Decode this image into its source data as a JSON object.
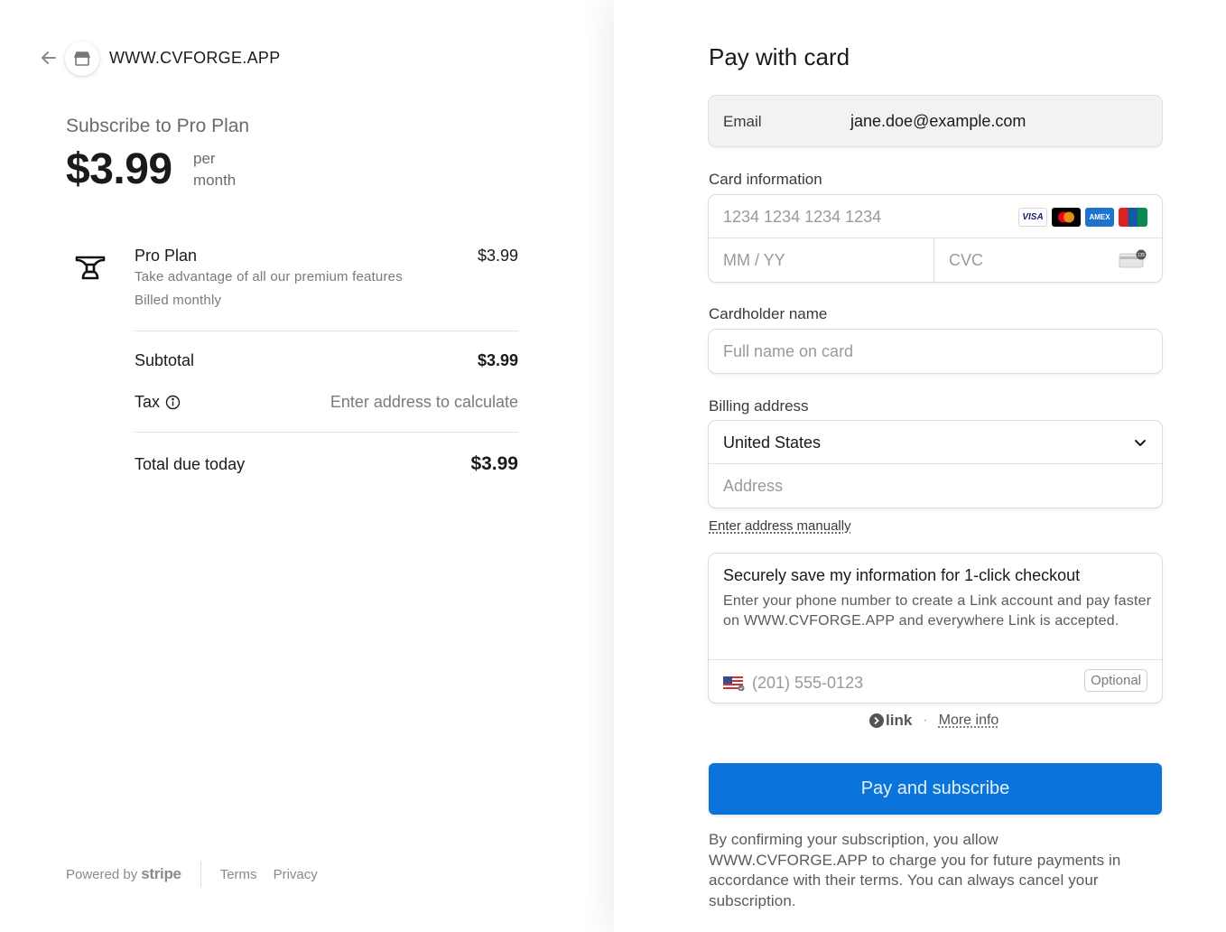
{
  "merchant": {
    "name": "WWW.CVFORGE.APP"
  },
  "summary": {
    "title": "Subscribe to Pro Plan",
    "price": "$3.99",
    "per_line1": "per",
    "per_line2": "month"
  },
  "line_item": {
    "name": "Pro Plan",
    "description": "Take advantage of all our premium features",
    "billing": "Billed monthly",
    "price": "$3.99"
  },
  "totals": {
    "subtotal_label": "Subtotal",
    "subtotal_value": "$3.99",
    "tax_label": "Tax",
    "tax_value": "Enter address to calculate",
    "total_label": "Total due today",
    "total_value": "$3.99"
  },
  "footer": {
    "powered_by": "Powered by",
    "brand": "stripe",
    "terms": "Terms",
    "privacy": "Privacy"
  },
  "payment": {
    "title": "Pay with card",
    "email_label": "Email",
    "email_value": "jane.doe@example.com",
    "card_label": "Card information",
    "card_number_placeholder": "1234 1234 1234 1234",
    "expiry_placeholder": "MM / YY",
    "cvc_placeholder": "CVC",
    "card_brands": [
      "VISA",
      "Mastercard",
      "AMEX",
      "UnionPay"
    ],
    "cardholder_label": "Cardholder name",
    "cardholder_placeholder": "Full name on card",
    "billing_label": "Billing address",
    "country_value": "United States",
    "address_placeholder": "Address",
    "manual_link": "Enter address manually"
  },
  "link_save": {
    "title": "Securely save my information for 1-click checkout",
    "description": "Enter your phone number to create a Link account and pay faster on WWW.CVFORGE.APP and everywhere Link is accepted.",
    "phone_placeholder": "(201) 555-0123",
    "optional_badge": "Optional",
    "brand": "link",
    "more_info": "More info"
  },
  "submit": {
    "label": "Pay and subscribe",
    "disclaimer": "By confirming your subscription, you allow WWW.CVFORGE.APP to charge you for future payments in accordance with their terms. You can always cancel your subscription."
  },
  "colors": {
    "primary_button": "#0a74da",
    "muted_text": "#7a7a7a"
  }
}
